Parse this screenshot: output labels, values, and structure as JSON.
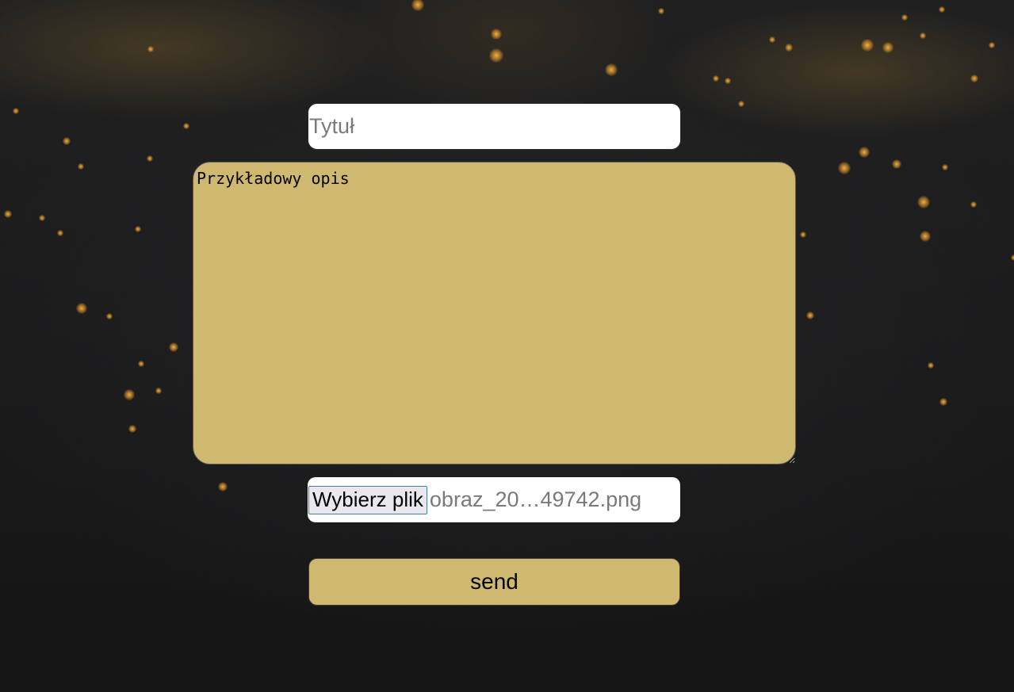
{
  "form": {
    "title_placeholder": "Tytuł",
    "title_value": "",
    "description_value": "Przykładowy opis",
    "file_button_label": "Wybierz plik",
    "file_name": "obraz_20…49742.png",
    "send_label": "send"
  },
  "colors": {
    "accent": "#cfb870",
    "background": "#1a1a1b",
    "input_background": "#ffffff",
    "placeholder": "#7a7a7a"
  }
}
